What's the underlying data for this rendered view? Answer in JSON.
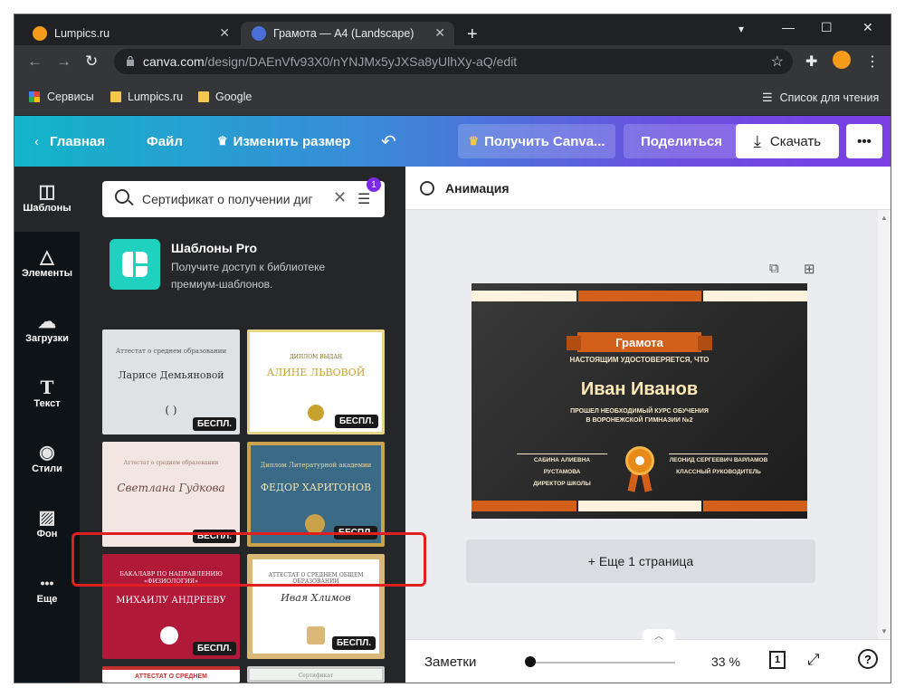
{
  "browser": {
    "tabs": [
      {
        "title": "Lumpics.ru",
        "favicon_color": "#f59b1c"
      },
      {
        "title": "Грамота — A4 (Landscape)",
        "favicon_color": "#4b6fd8"
      }
    ],
    "url_domain": "canva.com",
    "url_path": "/design/DAEnVfv93X0/nYNJMx5yJXSa8yUlhXy-aQ/edit",
    "bookmarks": [
      "Сервисы",
      "Lumpics.ru",
      "Google"
    ],
    "reading_list": "Список для чтения"
  },
  "header": {
    "home": "Главная",
    "file": "Файл",
    "resize": "Изменить размер",
    "get_pro": "Получить Canva...",
    "share": "Поделиться",
    "download": "Скачать",
    "more": "•••"
  },
  "rail": [
    {
      "label": "Шаблоны",
      "icon": "layout-icon",
      "glyph": "◫"
    },
    {
      "label": "Элементы",
      "icon": "shapes-icon",
      "glyph": "△"
    },
    {
      "label": "Загрузки",
      "icon": "upload-cloud-icon",
      "glyph": "☁"
    },
    {
      "label": "Текст",
      "icon": "text-icon",
      "glyph": "T"
    },
    {
      "label": "Стили",
      "icon": "palette-icon",
      "glyph": "◉"
    },
    {
      "label": "Фон",
      "icon": "background-pattern-icon",
      "glyph": "▨"
    },
    {
      "label": "Еще",
      "icon": "more-dots-icon",
      "glyph": "•••"
    }
  ],
  "panel": {
    "search_value": "Сертификат о получении диг",
    "filter_count": "1",
    "pro_title": "Шаблоны Pro",
    "pro_text": "Получите доступ к библиотеке премиум-шаблонов.",
    "free_label": "БЕСПЛ.",
    "templates": [
      {
        "heading": "Аттестат о среднем образовании",
        "name": "Ларисе Демьяновой"
      },
      {
        "heading": "ДИПЛОМ ВЫДАН",
        "name": "АЛИНЕ ЛЬВОВОЙ"
      },
      {
        "heading": "Аттестат о среднем образовании",
        "name": "Светлана Гудкова"
      },
      {
        "heading": "Диплом Литературной академии",
        "name": "ФЕДОР ХАРИТОНОВ"
      },
      {
        "heading": "БАКАЛАВР ПО НАПРАВЛЕНИЮ «ФИЗИОЛОГИЯ»",
        "name": "МИХАИЛУ АНДРЕЕВУ"
      },
      {
        "heading": "АТТЕСТАТ О СРЕДНЕМ ОБЩЕМ ОБРАЗОВАНИИ",
        "name": "Ивая Хлимов"
      },
      {
        "heading": "АТТЕСТАТ О СРЕДНЕМ",
        "name": ""
      },
      {
        "heading": "Сертификат",
        "name": ""
      }
    ]
  },
  "editor": {
    "animation": "Анимация",
    "add_page": "+ Еще 1 страница",
    "notes": "Заметки",
    "zoom": "33 %",
    "zoom_fraction": 0.0,
    "page_number": "1",
    "help": "?"
  },
  "certificate": {
    "title": "Грамота",
    "line1": "НАСТОЯЩИМ УДОСТОВЕРЯЕТСЯ, ЧТО",
    "name": "Иван Иванов",
    "line2": "ПРОШЕЛ НЕОБХОДИМЫЙ КУРС ОБУЧЕНИЯ",
    "line3": "В ВОРОНЕЖСКОЙ ГИМНАЗИИ №2",
    "sig_left_name": "САБИНА АЛИЕВНА РУСТАМОВА",
    "sig_left_role": "ДИРЕКТОР ШКОЛЫ",
    "sig_right_name": "ЛЕОНИД СЕРГЕЕВИЧ ВАРЛАМОВ",
    "sig_right_role": "КЛАССНЫЙ РУКОВОДИТЕЛЬ",
    "accent": "#d2601a",
    "cream": "#fbf3dc"
  }
}
